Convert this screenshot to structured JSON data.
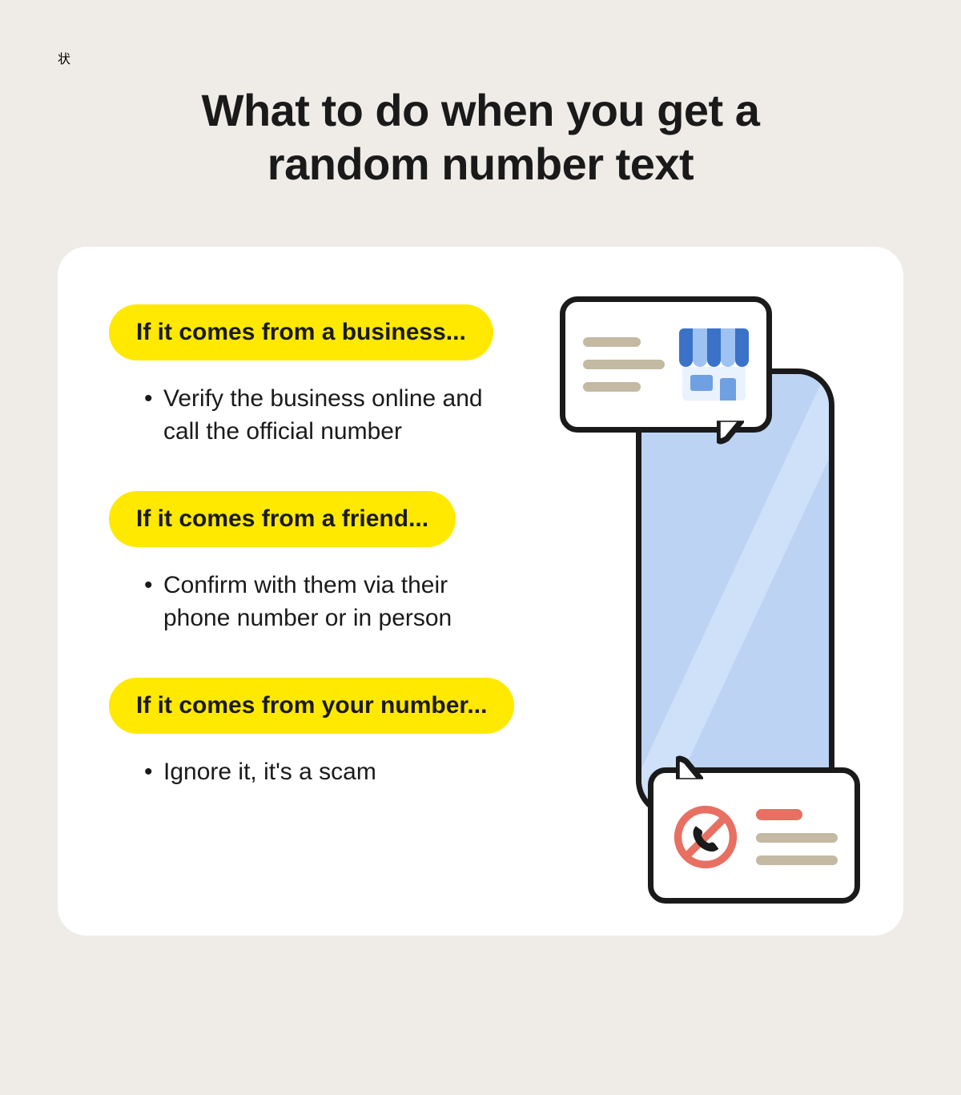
{
  "title": "What to do when you get a random number text",
  "sections": [
    {
      "heading": "If it comes from a business...",
      "bullet": "Verify the business online and call the official number"
    },
    {
      "heading": "If it comes from a friend...",
      "bullet": "Confirm with them via their phone number or in person"
    },
    {
      "heading": "If it comes from your number...",
      "bullet": "Ignore it, it's a scam"
    }
  ],
  "icons": {
    "store": "store-icon",
    "noCall": "no-call-icon",
    "phone": "phone-icon",
    "bubbleTop": "speech-bubble-store",
    "bubbleBottom": "speech-bubble-no-call"
  },
  "colors": {
    "bg": "#efece7",
    "card": "#ffffff",
    "pill": "#ffe900",
    "ink": "#1a1a1a",
    "barTan": "#c4b9a3",
    "barRed": "#e77062",
    "phoneFill": "#bcd3f4",
    "blueDark": "#3a72c7",
    "blueLight": "#9ec3f2"
  }
}
